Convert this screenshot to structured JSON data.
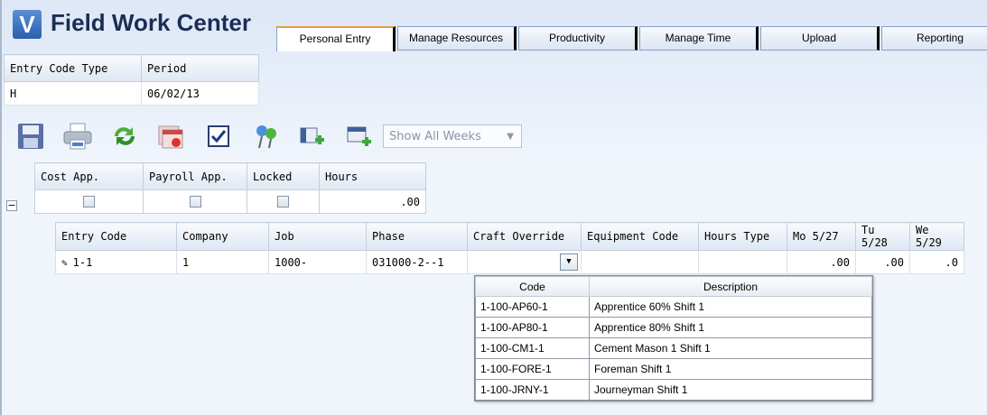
{
  "app": {
    "title": "Field Work Center",
    "logo_letter": "V"
  },
  "tabs": [
    {
      "label": "Personal Entry",
      "active": true
    },
    {
      "label": "Manage Resources",
      "active": false
    },
    {
      "label": "Productivity",
      "active": false
    },
    {
      "label": "Manage Time",
      "active": false
    },
    {
      "label": "Upload",
      "active": false
    },
    {
      "label": "Reporting",
      "active": false
    }
  ],
  "entry_header": {
    "columns": [
      "Entry Code Type",
      "Period"
    ],
    "values": [
      "H",
      "06/02/13"
    ]
  },
  "toolbar": {
    "icons": [
      "save-icon",
      "print-icon",
      "refresh-icon",
      "calendar-icon",
      "checkbox-icon",
      "pin-icon",
      "add-column-icon",
      "add-row-icon"
    ],
    "week_filter": "Show All Weeks"
  },
  "approval_grid": {
    "columns": [
      "Cost App.",
      "Payroll App.",
      "Locked",
      "Hours"
    ],
    "hours": ".00"
  },
  "lines_grid": {
    "columns": [
      "Entry Code",
      "Company",
      "Job",
      "Phase",
      "Craft Override",
      "Equipment Code",
      "Hours Type",
      "Mo 5/27",
      "Tu 5/28",
      "We 5/29"
    ],
    "row": [
      "1-1",
      "1",
      "1000-",
      "031000-2--1",
      "",
      "",
      "",
      ".00",
      ".00",
      ".0"
    ]
  },
  "craft_dropdown": {
    "columns": [
      "Code",
      "Description"
    ],
    "rows": [
      [
        "1-100-AP60-1",
        "Apprentice 60% Shift 1"
      ],
      [
        "1-100-AP80-1",
        "Apprentice 80% Shift 1"
      ],
      [
        "1-100-CM1-1",
        "Cement Mason 1 Shift 1"
      ],
      [
        "1-100-FORE-1",
        "Foreman Shift 1"
      ],
      [
        "1-100-JRNY-1",
        "Journeyman Shift 1"
      ]
    ]
  },
  "colors": {
    "accent": "#e49b3c",
    "title": "#1a2d55"
  }
}
